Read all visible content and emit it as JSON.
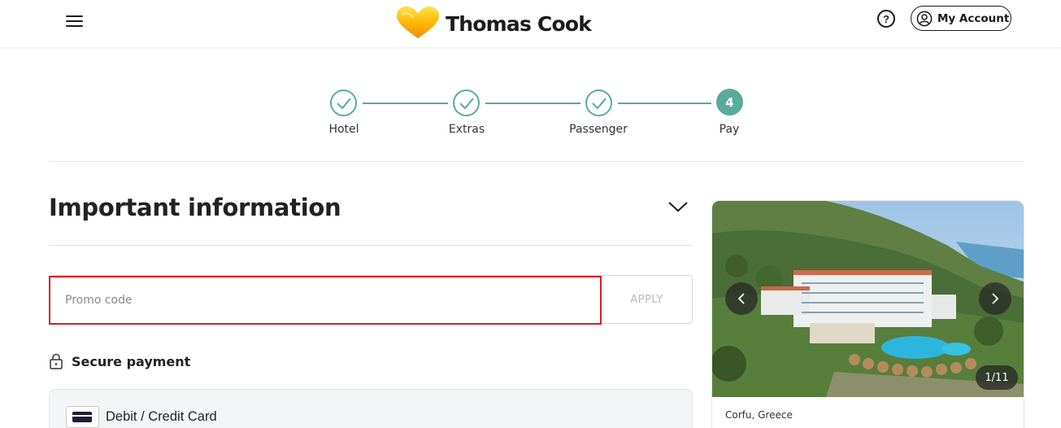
{
  "header": {
    "brand": "Thomas Cook",
    "help_symbol": "?",
    "account_label": "My Account"
  },
  "stepper": {
    "steps": [
      {
        "label": "Hotel",
        "state": "completed"
      },
      {
        "label": "Extras",
        "state": "completed"
      },
      {
        "label": "Passenger",
        "state": "completed"
      },
      {
        "label": "Pay",
        "number": "4",
        "state": "active"
      }
    ]
  },
  "info": {
    "title": "Important information"
  },
  "promo": {
    "placeholder": "Promo code",
    "value": "",
    "apply_label": "APPLY"
  },
  "payment": {
    "secure_label": "Secure payment",
    "method_label": "Debit / Credit Card"
  },
  "gallery": {
    "counter": "1/11",
    "location": "Corfu, Greece"
  },
  "colors": {
    "accent": "#5aab9b",
    "error": "#d71e1e",
    "brand_yellow": "#ffc600"
  }
}
